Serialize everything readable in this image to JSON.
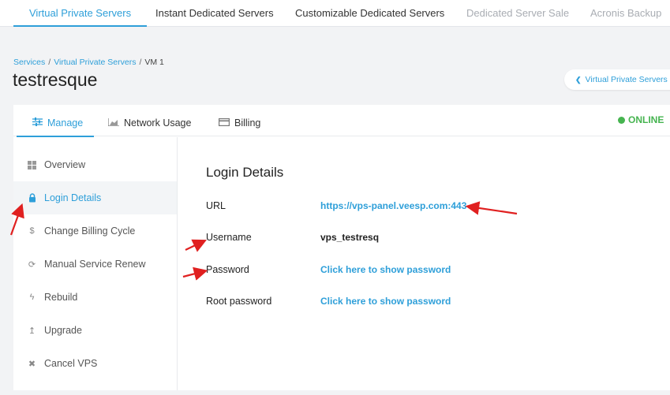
{
  "top_nav": {
    "tabs": [
      {
        "label": "Virtual Private Servers",
        "state": "active"
      },
      {
        "label": "Instant Dedicated Servers",
        "state": "normal"
      },
      {
        "label": "Customizable Dedicated Servers",
        "state": "normal"
      },
      {
        "label": "Dedicated Server Sale",
        "state": "muted"
      },
      {
        "label": "Acronis Backup",
        "state": "muted"
      }
    ]
  },
  "breadcrumb": {
    "items": [
      "Services",
      "Virtual Private Servers",
      "VM 1"
    ],
    "separator": "/"
  },
  "page_title": "testresque",
  "back_button": {
    "label": "Virtual Private Servers",
    "icon": "chevron-left-icon"
  },
  "card_tabs": [
    {
      "label": "Manage",
      "icon": "sliders-icon",
      "active": true
    },
    {
      "label": "Network Usage",
      "icon": "area-chart-icon",
      "active": false
    },
    {
      "label": "Billing",
      "icon": "credit-card-icon",
      "active": false
    }
  ],
  "status": {
    "label": "ONLINE",
    "color": "#46b450"
  },
  "sidebar": {
    "items": [
      {
        "label": "Overview",
        "icon": "grid-icon",
        "active": false
      },
      {
        "label": "Login Details",
        "icon": "lock-icon",
        "active": true
      },
      {
        "label": "Change Billing Cycle",
        "icon": "dollar-icon",
        "active": false
      },
      {
        "label": "Manual Service Renew",
        "icon": "refresh-icon",
        "active": false
      },
      {
        "label": "Rebuild",
        "icon": "bolt-icon",
        "active": false
      },
      {
        "label": "Upgrade",
        "icon": "arrow-up-icon",
        "active": false
      },
      {
        "label": "Cancel VPS",
        "icon": "close-icon",
        "active": false
      }
    ]
  },
  "login_details": {
    "title": "Login Details",
    "rows": [
      {
        "label": "URL",
        "value": "https://vps-panel.veesp.com:443",
        "type": "link"
      },
      {
        "label": "Username",
        "value": "vps_testresq",
        "type": "plain"
      },
      {
        "label": "Password",
        "value": "Click here to show password",
        "type": "link"
      },
      {
        "label": "Root password",
        "value": "Click here to show password",
        "type": "link"
      }
    ]
  },
  "colors": {
    "accent": "#2e9fd9",
    "annotation_arrow": "#e02020",
    "background": "#f2f3f5"
  }
}
